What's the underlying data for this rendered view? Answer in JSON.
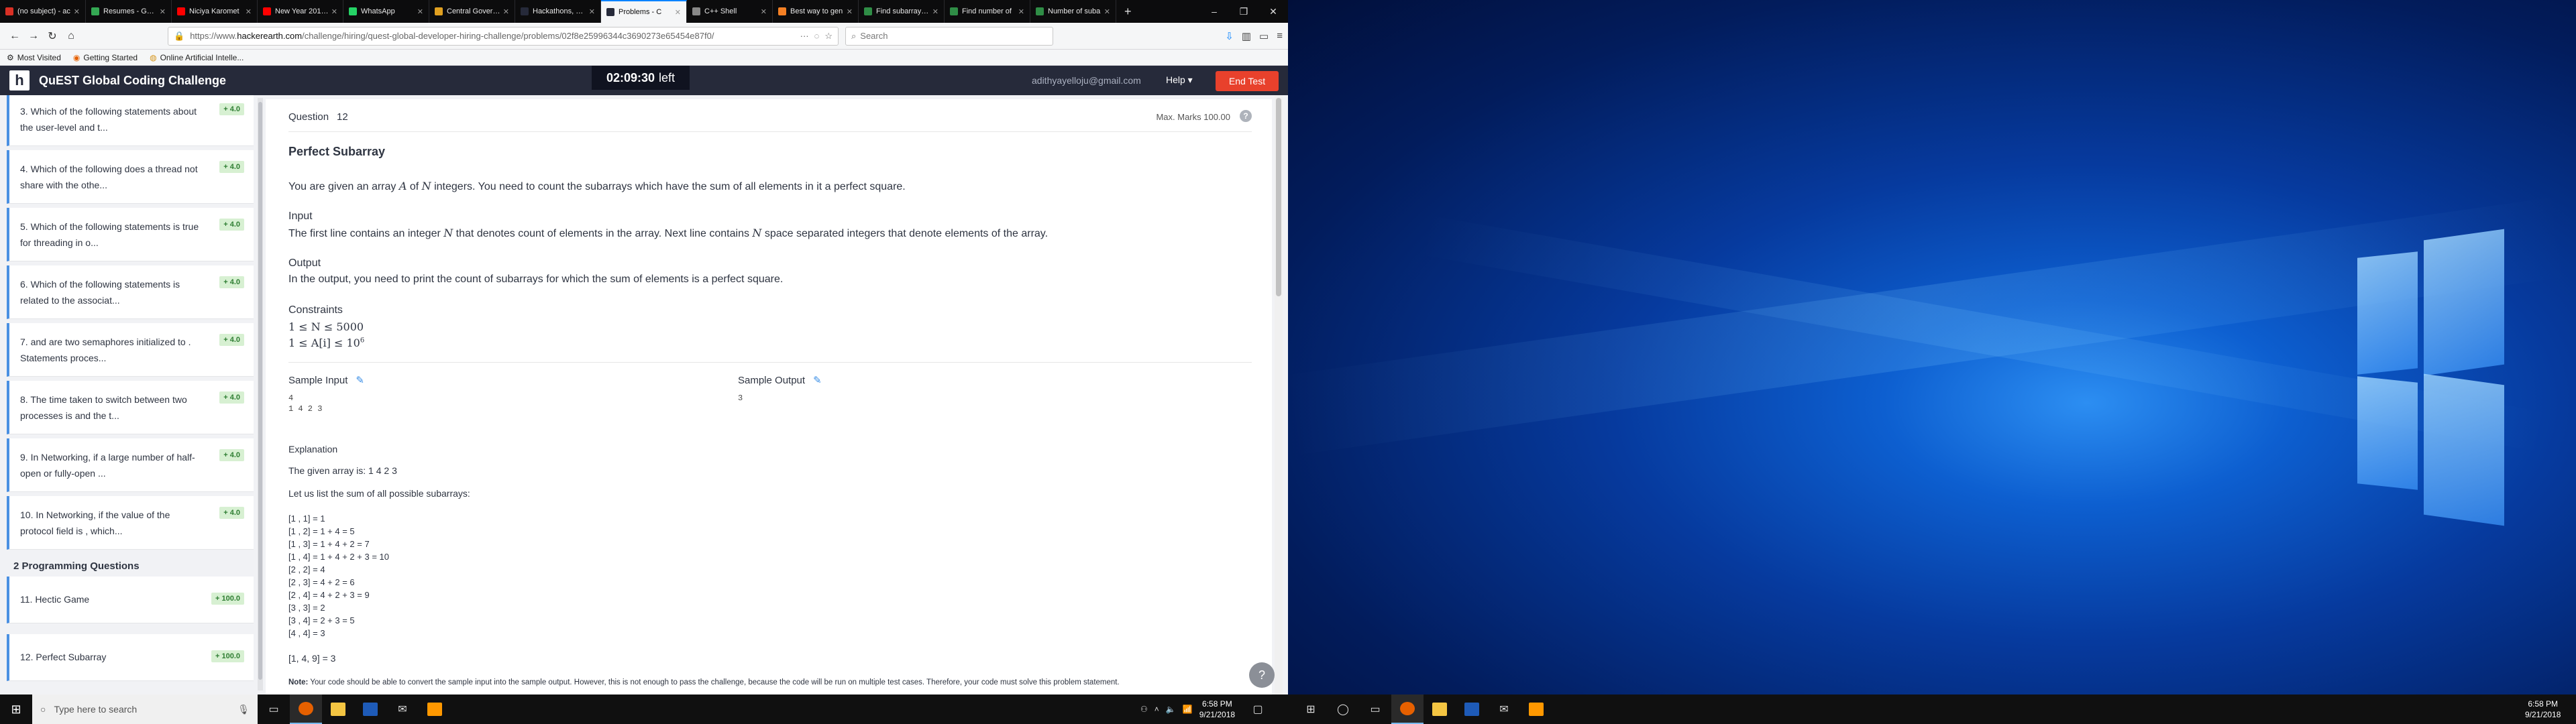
{
  "browser": {
    "tabs": [
      {
        "label": "(no subject) - ac",
        "color": "#d93025"
      },
      {
        "label": "Resumes - Goog",
        "color": "#34a853"
      },
      {
        "label": "Niciya Karomet",
        "color": "#ff0000"
      },
      {
        "label": "New Year 2018 !",
        "color": "#ff0000"
      },
      {
        "label": "WhatsApp",
        "color": "#25d366"
      },
      {
        "label": "Central Governm",
        "color": "#e0a020"
      },
      {
        "label": "Hackathons, Pro",
        "color": "#262a3a"
      },
      {
        "label": "Problems - C",
        "color": "#262a3a",
        "active": true
      },
      {
        "label": "C++ Shell",
        "color": "#888888"
      },
      {
        "label": "Best way to gen",
        "color": "#f48024"
      },
      {
        "label": "Find subarray wi",
        "color": "#2f8d46"
      },
      {
        "label": "Find number of",
        "color": "#2f8d46"
      },
      {
        "label": "Number of suba",
        "color": "#2f8d46"
      }
    ],
    "url_prefix": "https://www.",
    "url_host": "hackerearth.com",
    "url_path": "/challenge/hiring/quest-global-developer-hiring-challenge/problems/02f8e25996344c3690273e65454e87f0/",
    "search_placeholder": "Search",
    "bookmarks": [
      "Most Visited",
      "Getting Started",
      "Online Artificial Intelle..."
    ]
  },
  "header": {
    "title": "QuEST Global Coding Challenge",
    "timer": "02:09:30",
    "timer_suffix": "left",
    "email": "adithyayelloju@gmail.com",
    "help": "Help",
    "end_test": "End Test"
  },
  "sidebar": {
    "questions": [
      {
        "text": "3. Which of the following statements about the user-level and t...",
        "badge": "+ 4.0"
      },
      {
        "text": "4. Which of the following does a thread not share with the othe...",
        "badge": "+ 4.0"
      },
      {
        "text": "5. Which of the following statements is true for threading in o...",
        "badge": "+ 4.0"
      },
      {
        "text": "6. Which of the following statements is related to the associat...",
        "badge": "+ 4.0"
      },
      {
        "text": "7.  and  are two semaphores initialized to . Statements proces...",
        "badge": "+ 4.0"
      },
      {
        "text": "8. The time taken to switch between two processes is and the t...",
        "badge": "+ 4.0"
      },
      {
        "text": "9. In Networking, if a large number of half-open or fully-open ...",
        "badge": "+ 4.0"
      },
      {
        "text": "10. In Networking, if the value of the protocol field is , which...",
        "badge": "+ 4.0"
      }
    ],
    "programming_heading": "2 Programming Questions",
    "programming": [
      {
        "text": "11. Hectic Game",
        "badge": "+ 100.0"
      },
      {
        "text": "12. Perfect Subarray",
        "badge": "+ 100.0"
      }
    ]
  },
  "problem": {
    "question_label": "Question",
    "question_number": "12",
    "max_marks": "Max. Marks 100.00",
    "title": "Perfect Subarray",
    "statement": "You are given an array A of N integers. You need to count the subarrays which have the sum of all elements in it a perfect square.",
    "input_heading": "Input",
    "input_text": "The first line contains an integer N that denotes count of elements in the array. Next line contains N space separated integers that denote elements of the array.",
    "output_heading": "Output",
    "output_text": "In the output, you need to print the count of subarrays for which the sum of elements is a perfect square.",
    "constraints_heading": "Constraints",
    "constraint_1": "1 ≤ N ≤ 5000",
    "constraint_2": "1 ≤ A[i] ≤ 10",
    "constraint_2_sup": "6",
    "sample_input_label": "Sample Input",
    "sample_input": "4\n1 4 2 3",
    "sample_output_label": "Sample Output",
    "sample_output": "3",
    "explanation_heading": "Explanation",
    "explanation_1": "The given array is: 1 4 2 3",
    "explanation_2": "Let us list the sum of all possible subarrays:",
    "subarray_list": "[1 , 1] = 1\n[1 , 2] = 1 + 4 = 5\n[1 , 3] = 1 + 4 + 2 = 7\n[1 , 4] = 1 + 4 + 2 + 3 = 10\n[2 , 2] = 4\n[2 , 3] = 4 + 2 = 6\n[2 , 4] = 4 + 2 + 3 = 9\n[3 , 3] = 2\n[3 , 4] = 2 + 3 = 5\n[4 , 4] = 3",
    "answer_line": "[1, 4, 9] = 3",
    "note_label": "Note:",
    "note_text": "Your code should be able to convert the sample input into the sample output. However, this is not enough to pass the challenge, because the code will be run on multiple test cases. Therefore, your code must solve this problem statement."
  },
  "taskbar": {
    "search_placeholder": "Type here to search",
    "time": "6:58 PM",
    "date": "9/21/2018"
  }
}
